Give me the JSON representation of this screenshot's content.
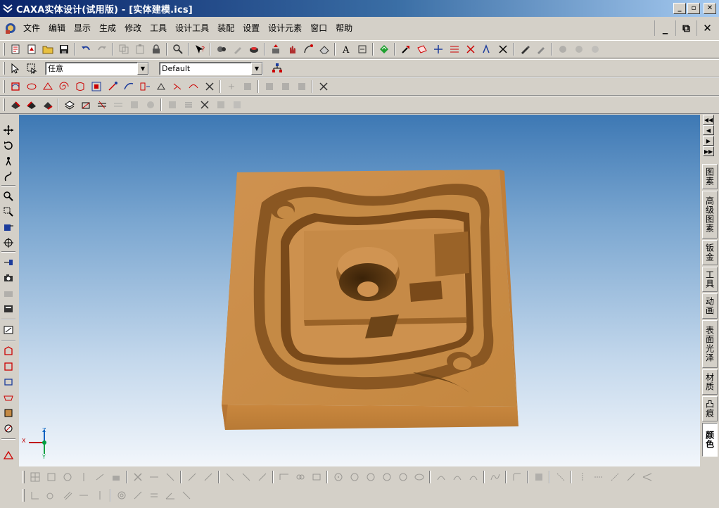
{
  "window": {
    "title": "CAXA实体设计(试用版) - [实体建模.ics]",
    "buttons": {
      "minimize": "_",
      "restore": "▫",
      "close": "✕"
    }
  },
  "menu": {
    "items": [
      "文件",
      "编辑",
      "显示",
      "生成",
      "修改",
      "工具",
      "设计工具",
      "装配",
      "设置",
      "设计元素",
      "窗口",
      "帮助"
    ],
    "mdi_buttons": {
      "minimize": "_",
      "restore": "⧉",
      "close": "✕"
    }
  },
  "selection": {
    "filter_value": "任意",
    "style_value": "Default"
  },
  "right_tabs": {
    "items": [
      "图素",
      "高级图素",
      "钣金",
      "工具",
      "动画",
      "表面光泽",
      "材质",
      "凸痕",
      "颜色"
    ],
    "active": "颜色"
  },
  "axes": {
    "x": "X",
    "y": "Y",
    "z": "Z"
  },
  "colors": {
    "part": "#c58a45",
    "part_top": "#c98c49",
    "part_dark": "#8a5a24",
    "part_shadow": "#6e4518",
    "sky_top": "#3d78b4",
    "sky_bottom": "#f2f6fb"
  },
  "icons": {
    "toolbar1": [
      "new-design-icon",
      "new-drawing-icon",
      "open-icon",
      "save-icon",
      "undo-icon",
      "redo-icon",
      "copy-icon",
      "paste-icon",
      "delete-icon",
      "find-icon",
      "help-icon",
      "edit-icon",
      "tool-icon",
      "render-icon",
      "fillet-icon",
      "chamfer-icon",
      "shell-icon",
      "pattern-icon",
      "text-icon",
      "dimension-icon",
      "smart-icon",
      "arrow-icon",
      "plane-icon",
      "point-icon",
      "measure-icon",
      "snap-icon",
      "cross-icon",
      "eyedropper-icon",
      "paint-icon"
    ],
    "viewport_tools": [
      "move-icon",
      "rotate-icon",
      "walk-icon",
      "fly-icon",
      "zoom-icon",
      "zoom-window-icon",
      "zoom-fit-icon",
      "look-icon",
      "target-icon",
      "camera-icon",
      "view-icon",
      "render-icon",
      "section-icon",
      "box-icon",
      "sketch-icon",
      "wire-icon",
      "material-icon",
      "circle-icon",
      "measure-icon"
    ]
  }
}
